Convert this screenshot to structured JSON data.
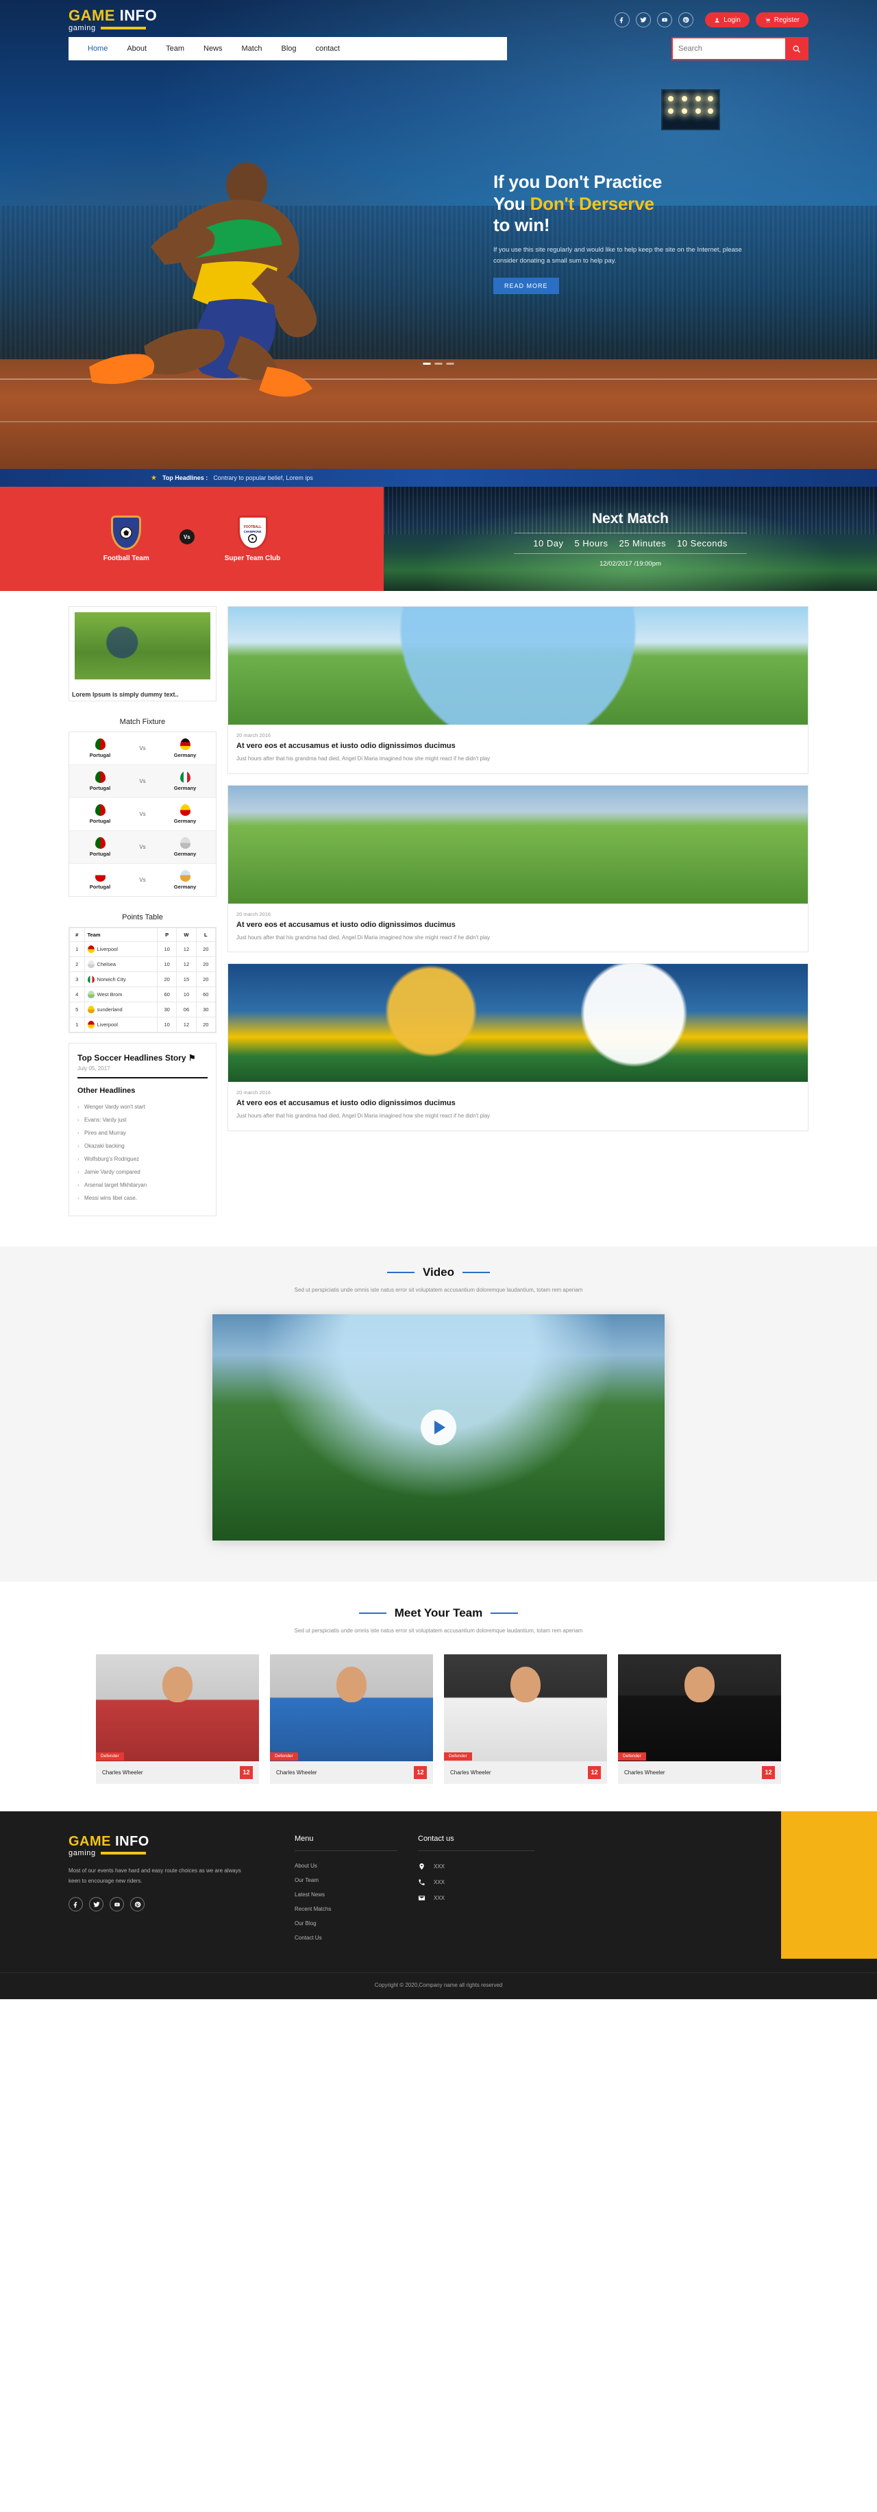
{
  "header": {
    "logo": {
      "part1": "GAME",
      "part2": "INFO",
      "tagline": "gaming"
    },
    "social": [
      "facebook-icon",
      "twitter-icon",
      "youtube-icon",
      "pinterest-icon"
    ],
    "login_label": "Login",
    "register_label": "Register",
    "nav": [
      "Home",
      "About",
      "Team",
      "News",
      "Match",
      "Blog",
      "contact"
    ],
    "search_placeholder": "Search",
    "search_value": ""
  },
  "hero": {
    "title_line1": "If you Don't Practice",
    "title_line2_plain": "You ",
    "title_line2_highlight": "Don't Derserve",
    "title_line3": "to win!",
    "description": "If you use this site regularly and would like to help keep the site on the Internet, please consider donating a small sum to help pay.",
    "button": "READ MORE"
  },
  "ticker": {
    "label": "Top Headlines :",
    "text": "Contrary to popular belief, Lorem ips"
  },
  "match_banner": {
    "home_team": "Football Team",
    "away_team": "Super Team Club",
    "vs": "Vs",
    "crest_away_line1": "FOOTBALL",
    "crest_away_line2": "CHAMPIONS",
    "next_match_title": "Next Match",
    "countdown": [
      "10 Day",
      "5 Hours",
      "25 Minutes",
      "10 Seconds"
    ],
    "datetime": "12/02/2017 /19:00pm"
  },
  "sidebar": {
    "feature_caption": "Lorem Ipsum is simply dummy text..",
    "fixture_title": "Match Fixture",
    "fixtures": [
      {
        "home": "Portugal",
        "vs": "Vs",
        "away": "Germany"
      },
      {
        "home": "Portugal",
        "vs": "Vs",
        "away": "Germany"
      },
      {
        "home": "Portugal",
        "vs": "Vs",
        "away": "Germany"
      },
      {
        "home": "Portugal",
        "vs": "Vs",
        "away": "Germany"
      },
      {
        "home": "Portugal",
        "vs": "Vs",
        "away": "Germany"
      }
    ],
    "points_title": "Points Table",
    "points_headers": [
      "#",
      "Team",
      "P",
      "W",
      "L"
    ],
    "points_rows": [
      {
        "rank": "1",
        "team": "Liverpool",
        "p": "10",
        "w": "12",
        "l": "20"
      },
      {
        "rank": "2",
        "team": "Chelsea",
        "p": "10",
        "w": "12",
        "l": "20"
      },
      {
        "rank": "3",
        "team": "Norwich City",
        "p": "20",
        "w": "15",
        "l": "20"
      },
      {
        "rank": "4",
        "team": "West Brom",
        "p": "60",
        "w": "10",
        "l": "60"
      },
      {
        "rank": "5",
        "team": "sunderland",
        "p": "30",
        "w": "06",
        "l": "30"
      },
      {
        "rank": "1",
        "team": "Liverpool",
        "p": "10",
        "w": "12",
        "l": "20"
      }
    ],
    "headlines_title": "Top Soccer Headlines Story",
    "headlines_date": "July 05, 2017",
    "other_headlines_title": "Other Headlines",
    "other_headlines": [
      "Wenger Vardy won't start",
      "Evans: Vardy just",
      "Pires and Murray",
      "Okazaki backing",
      "Wolfsburg's Rodriguez",
      "Jamie Vardy compared",
      "Arsenal target Mkhitaryan",
      "Messi wins libel case."
    ]
  },
  "posts": [
    {
      "date": "20 march 2016",
      "title": "At vero eos et accusamus et iusto odio dignissimos ducimus",
      "text": "Just hours after that his grandma had died, Angel Di Maria imagined how she might react if he didn't play"
    },
    {
      "date": "20 march 2016",
      "title": "At vero eos et accusamus et iusto odio dignissimos ducimus",
      "text": "Just hours after that his grandma had died, Angel Di Maria imagined how she might react if he didn't play"
    },
    {
      "date": "20 march 2016",
      "title": "At vero eos et accusamus et iusto odio dignissimos ducimus",
      "text": "Just hours after that his grandma had died, Angel Di Maria imagined how she might react if he didn't play"
    }
  ],
  "video": {
    "title": "Video",
    "subtitle": "Sed ut perspiciatis unde omnis iste natus error sit voluptatem accusantium doloremque laudantium, totam rem aperiam"
  },
  "team_section": {
    "title": "Meet Your Team",
    "subtitle": "Sed ut perspiciatis unde omnis iste natus error sit voluptatem accusantium doloremque laudantium, totam rem aperiam",
    "players": [
      {
        "role": "Defender",
        "name": "Charles Wheeler",
        "number": "12"
      },
      {
        "role": "Defender",
        "name": "Charles Wheeler",
        "number": "12"
      },
      {
        "role": "Defender",
        "name": "Charles Wheeler",
        "number": "12"
      },
      {
        "role": "Defender",
        "name": "Charles Wheeler",
        "number": "12"
      }
    ]
  },
  "footer": {
    "logo": {
      "part1": "GAME",
      "part2": "INFO",
      "tagline": "gaming"
    },
    "description": "Most of our events have hard and easy route choices as we are always keen to encourage new riders.",
    "social": [
      "facebook-icon",
      "twitter-icon",
      "youtube-icon",
      "pinterest-icon"
    ],
    "menu_title": "Menu",
    "menu_items": [
      "About Us",
      "Our Team",
      "Latest News",
      "Recent Matchs",
      "Our Blog",
      "Contact Us"
    ],
    "contact_title": "Contact us",
    "contact_items": [
      {
        "icon": "location-icon",
        "value": "XXX"
      },
      {
        "icon": "phone-icon",
        "value": "XXX"
      },
      {
        "icon": "mail-icon",
        "value": "XXX"
      }
    ],
    "copyright": "Copyright © 2020,Company name all rights reserved"
  },
  "colors": {
    "accent_red": "#e53935",
    "accent_yellow": "#f5c417",
    "accent_blue": "#2a6fc4",
    "footer_bg": "#1c1c1c"
  }
}
